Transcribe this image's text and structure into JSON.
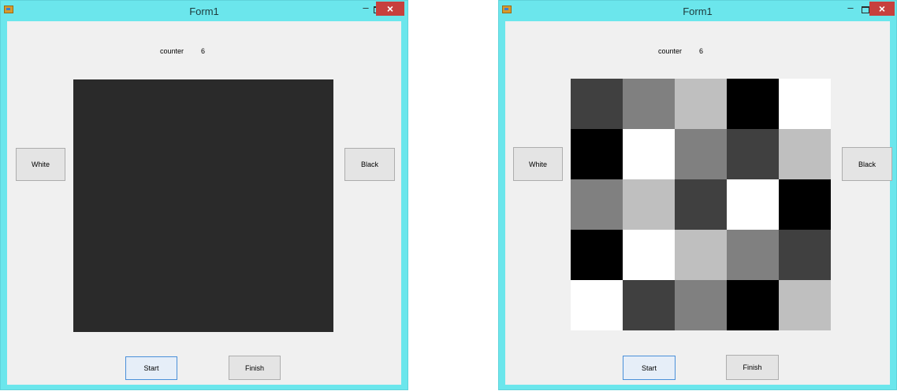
{
  "windows": [
    {
      "title": "Form1",
      "counter_label": "counter",
      "counter_value": "6",
      "white_button": "White",
      "black_button": "Black",
      "start_button": "Start",
      "finish_button": "Finish",
      "canvas_fill": "#2a2a2a"
    },
    {
      "title": "Form1",
      "counter_label": "counter",
      "counter_value": "6",
      "white_button": "White",
      "black_button": "Black",
      "start_button": "Start",
      "finish_button": "Finish",
      "grid_colors": [
        [
          "#404040",
          "#808080",
          "#bfbfbf",
          "#000000",
          "#ffffff"
        ],
        [
          "#000000",
          "#ffffff",
          "#808080",
          "#404040",
          "#bfbfbf"
        ],
        [
          "#808080",
          "#bfbfbf",
          "#404040",
          "#ffffff",
          "#000000"
        ],
        [
          "#000000",
          "#ffffff",
          "#bfbfbf",
          "#808080",
          "#404040"
        ],
        [
          "#ffffff",
          "#404040",
          "#808080",
          "#000000",
          "#bfbfbf"
        ]
      ]
    }
  ],
  "titlebar": {
    "minimize_icon": "minimize-icon",
    "maximize_icon": "maximize-icon",
    "close_icon": "close-icon",
    "close_glyph": "×",
    "minimize_glyph": "–"
  }
}
